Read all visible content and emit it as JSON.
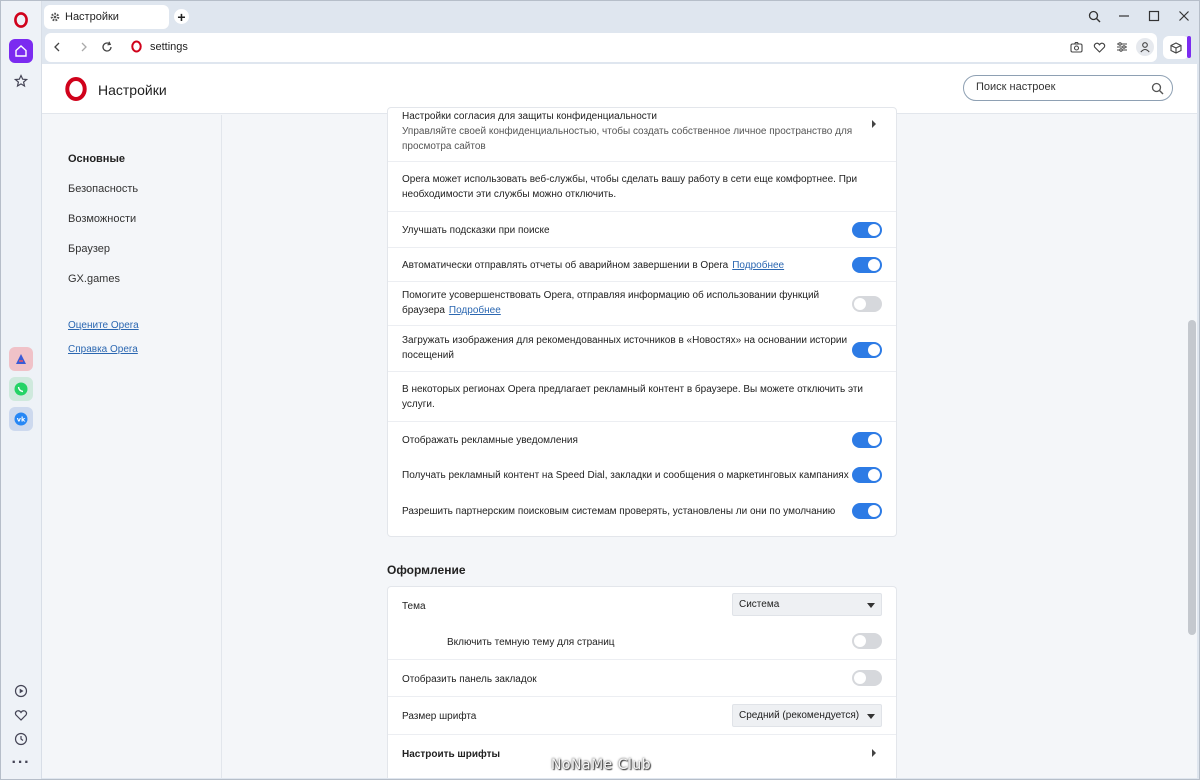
{
  "tab": {
    "title": "Настройки",
    "new_tab_label": "+"
  },
  "address_bar": {
    "url": "settings"
  },
  "page_header": {
    "title": "Настройки",
    "search_placeholder": "Поиск настроек"
  },
  "left_nav": {
    "items": [
      "Основные",
      "Безопасность",
      "Возможности",
      "Браузер",
      "GX.games"
    ],
    "active": "Основные",
    "links": [
      "Оцените Opera",
      "Справка Opera"
    ]
  },
  "privacy_card": {
    "consent_title": "Настройки согласия для защиты конфиденциальности",
    "consent_sub_1": "Управляйте своей конфиденциальностью, чтобы создать собственное личное пространство для",
    "consent_sub_2": "просмотра сайтов",
    "webservices_1": "Opera может использовать веб-службы, чтобы сделать вашу работу в сети еще комфортнее. При",
    "webservices_2": "необходимости эти службы можно отключить.",
    "improve_search": "Улучшать подсказки при поиске",
    "crash_reports": "Автоматически отправлять отчеты об аварийном завершении в Opera",
    "crash_reports_link": "Подробнее",
    "usage_info_1": "Помогите усовершенствовать Opera, отправляя информацию об использовании функций",
    "usage_info_2": "браузера",
    "usage_info_link": "Подробнее",
    "news_images_1": "Загружать изображения для рекомендованных источников в «Новостях» на основании истории",
    "news_images_2": "посещений",
    "ads_info_1": "В некоторых регионах Opera предлагает рекламный контент в браузере. Вы можете отключить эти",
    "ads_info_2": "услуги.",
    "ad_notifications": "Отображать рекламные уведомления",
    "speed_dial_ads": "Получать рекламный контент на Speed Dial, закладки и сообщения о маркетинговых кампаниях",
    "partner_search": "Разрешить партнерским поисковым системам проверять, установлены ли они по умолчанию",
    "toggles": {
      "improve_search": true,
      "crash_reports": true,
      "usage_info": false,
      "news_images": true,
      "ad_notifications": true,
      "speed_dial_ads": true,
      "partner_search": true
    }
  },
  "appearance": {
    "section_title": "Оформление",
    "theme_label": "Тема",
    "theme_value": "Система",
    "dark_pages_label": "Включить темную тему для страниц",
    "bookmarks_bar_label": "Отобразить панель закладок",
    "font_size_label": "Размер шрифта",
    "font_size_value": "Средний (рекомендуется)",
    "customize_fonts_label": "Настроить шрифты",
    "toggles": {
      "dark_pages": false,
      "bookmarks_bar": false
    }
  },
  "watermark": "NoNaMe Club",
  "colors": {
    "accent": "#2d7be5",
    "opera_red": "#d0021b",
    "sidebar_active": "#7b2bf0"
  }
}
